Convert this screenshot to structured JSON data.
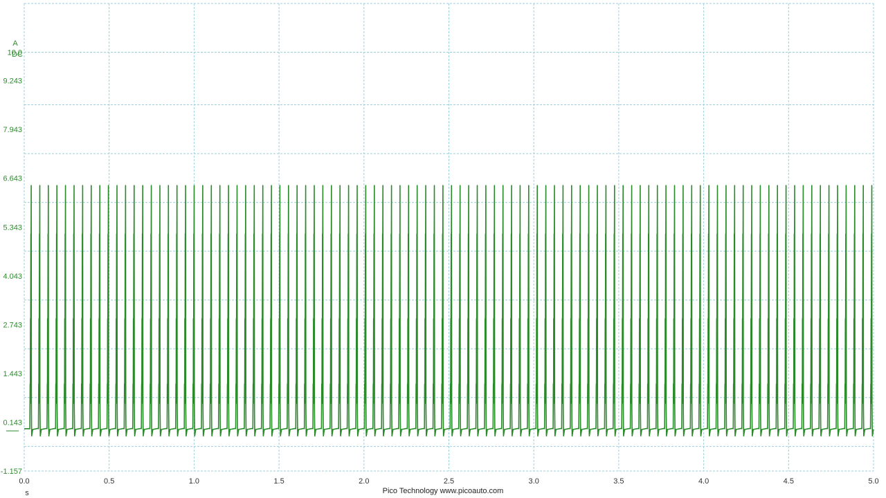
{
  "chart_data": {
    "type": "line",
    "title": "",
    "ylabel_unit": "A",
    "ylabel_coupling": "DC",
    "xlabel": "s",
    "xlim": [
      0.0,
      5.0
    ],
    "ylim": [
      -1.157,
      11.3
    ],
    "y_ticks": [
      "10.0",
      "9.243",
      "7.943",
      "6.643",
      "5.343",
      "4.043",
      "2.743",
      "1.443",
      "0.143",
      "-1.157"
    ],
    "y_tick_values": [
      10.0,
      9.243,
      7.943,
      6.643,
      5.343,
      4.043,
      2.743,
      1.443,
      0.143,
      -1.157
    ],
    "y_grid_values": [
      11.3,
      10.0,
      8.6,
      7.3,
      6.0,
      4.7,
      3.4,
      2.1,
      0.8,
      -0.5,
      -1.157
    ],
    "x_ticks": [
      "0.0",
      "0.5",
      "1.0",
      "1.5",
      "2.0",
      "2.5",
      "3.0",
      "3.5",
      "4.0",
      "4.5",
      "5.0"
    ],
    "x_tick_values": [
      0.0,
      0.5,
      1.0,
      1.5,
      2.0,
      2.5,
      3.0,
      3.5,
      4.0,
      4.5,
      5.0
    ],
    "grid": true,
    "series_color": "#2a8a2a",
    "grid_color": "#9ccfdc",
    "waveform": {
      "shape": "periodic current spikes",
      "period_s": 0.0505,
      "first_pulse_s": 0.045,
      "peak_A": 6.45,
      "baseline_A": -0.05,
      "undershoot_A": -0.22
    }
  },
  "footer": {
    "credit": "Pico Technology  www.picoauto.com"
  }
}
